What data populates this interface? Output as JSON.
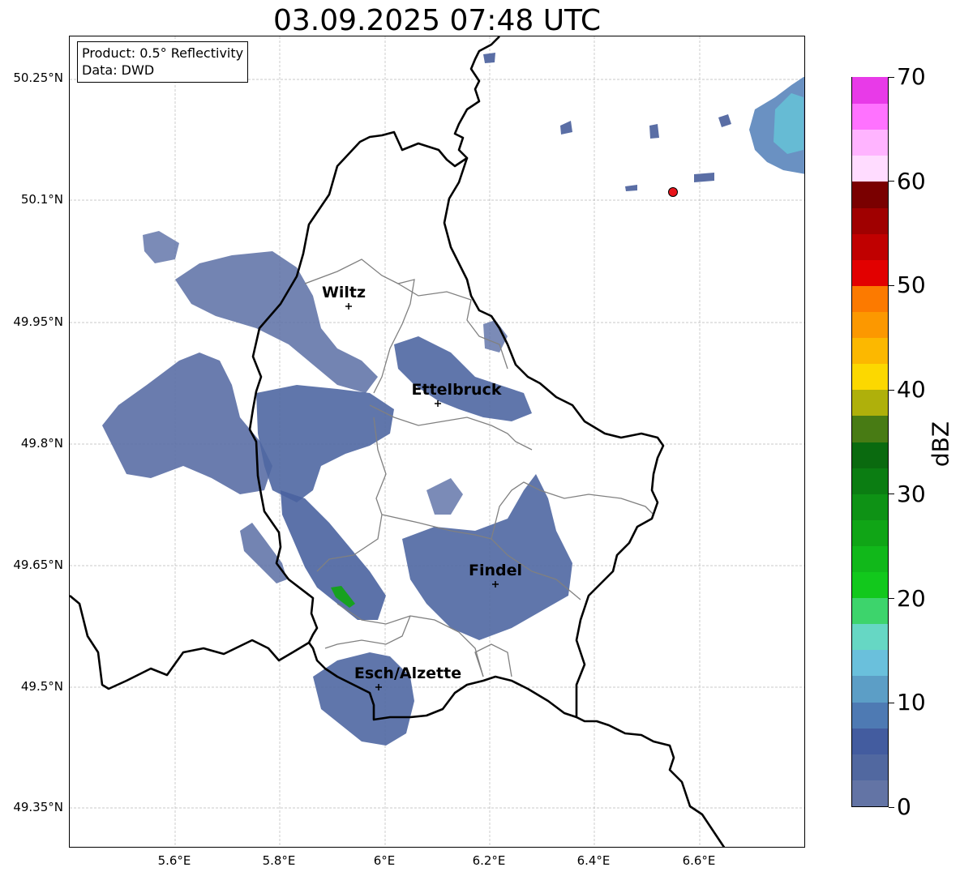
{
  "title": "03.09.2025 07:48 UTC",
  "info_box": {
    "product": "Product: 0.5° Reflectivity",
    "data": "Data: DWD"
  },
  "axes": {
    "lat_labels": [
      "50.25°N",
      "50.1°N",
      "49.95°N",
      "49.8°N",
      "49.65°N",
      "49.5°N",
      "49.35°N"
    ],
    "lon_labels": [
      "5.6°E",
      "5.8°E",
      "6°E",
      "6.2°E",
      "6.4°E",
      "6.6°E"
    ],
    "grid": true
  },
  "cities": [
    {
      "name": "Wiltz"
    },
    {
      "name": "Ettelbruck"
    },
    {
      "name": "Findel"
    },
    {
      "name": "Esch/Alzette"
    }
  ],
  "radar_site": {
    "color": "#e8141a"
  },
  "colorbar": {
    "title": "dBZ",
    "ticks": [
      "0",
      "10",
      "20",
      "30",
      "40",
      "50",
      "60",
      "70"
    ],
    "colors": [
      "#6374a5",
      "#5168a0",
      "#435c9f",
      "#4e7ab3",
      "#5c9ec6",
      "#6ac0dc",
      "#66d7c4",
      "#3dd46c",
      "#12c81c",
      "#11b81a",
      "#10a516",
      "#0e9215",
      "#0b7d12",
      "#0a6a0f",
      "#487b14",
      "#afb00b",
      "#fcd800",
      "#fcb800",
      "#fc9800",
      "#fc7a00",
      "#e20000",
      "#c00000",
      "#a00000",
      "#7a0000",
      "#ffdcff",
      "#ffb4ff",
      "#ff72ff",
      "#e83ae8"
    ]
  }
}
